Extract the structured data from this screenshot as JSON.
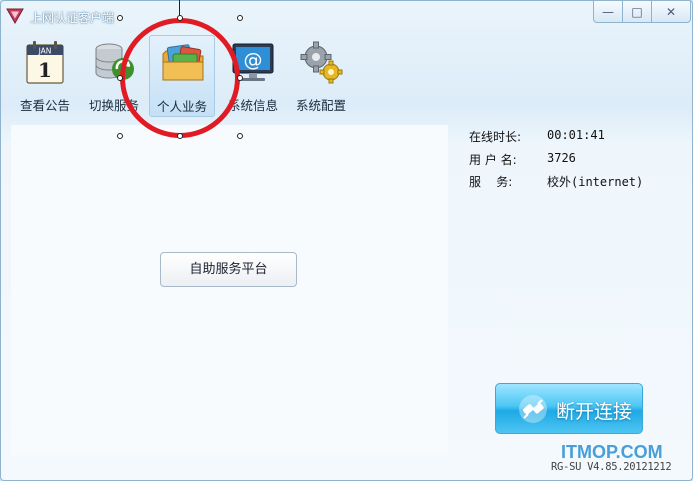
{
  "window": {
    "title": "上网认证客户端",
    "minimize": "—",
    "maximize": "□",
    "close": "✕"
  },
  "toolbar": {
    "items": [
      {
        "label": "查看公告",
        "icon": "calendar-icon"
      },
      {
        "label": "切换服务",
        "icon": "database-switch-icon"
      },
      {
        "label": "个人业务",
        "icon": "folder-card-icon"
      },
      {
        "label": "系统信息",
        "icon": "monitor-at-icon"
      },
      {
        "label": "系统配置",
        "icon": "gears-icon"
      }
    ],
    "calendar_month": "JAN",
    "calendar_day": "1",
    "monitor_symbol": "@"
  },
  "main": {
    "self_service_label": "自助服务平台"
  },
  "info": {
    "online_time_label": "在线时长:",
    "online_time_value": "00:01:41",
    "username_label": "用 户 名:",
    "username_value": "3726",
    "service_label": "服    务:",
    "service_value": "校外(internet)"
  },
  "disconnect": {
    "label": "断开连接",
    "icon": "plug-icon"
  },
  "footer": {
    "version": "RG-SU V4.85.20121212",
    "watermark": "ITMOP.COM"
  },
  "colors": {
    "annotation": "#e01b24",
    "accent": "#1ea9e6"
  }
}
